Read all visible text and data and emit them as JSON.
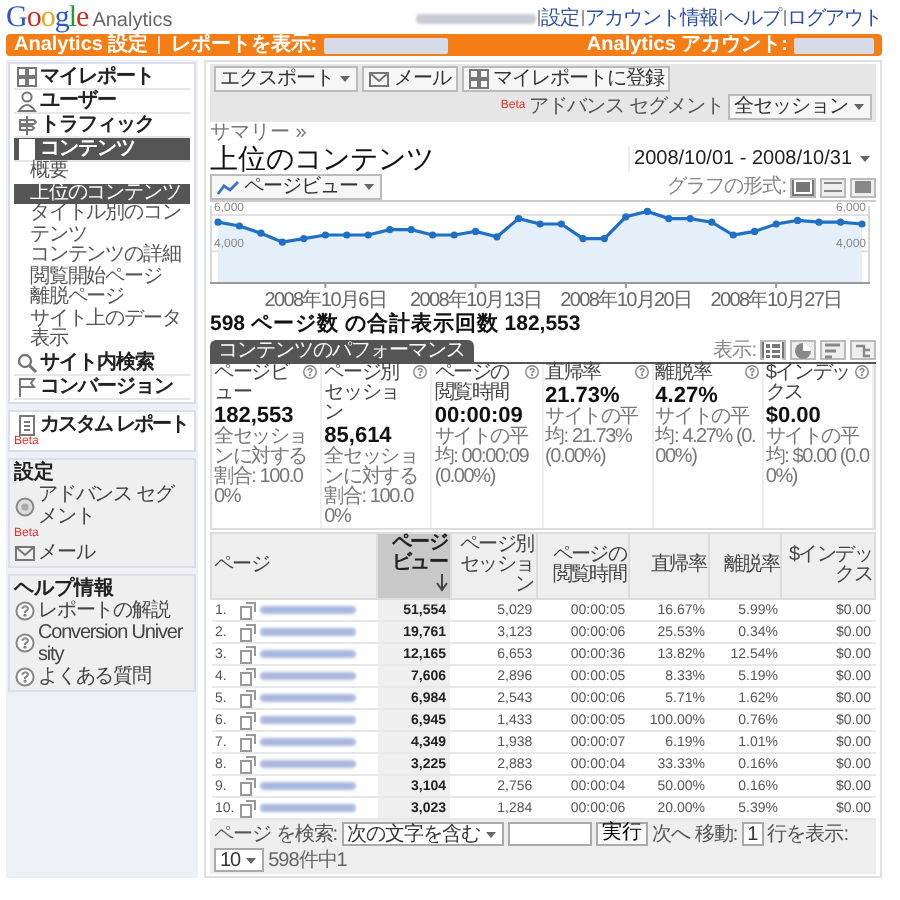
{
  "header": {
    "logo_word": "Google",
    "logo_product": "Analytics",
    "account_links": [
      "設定",
      "アカウント情報",
      "ヘルプ",
      "ログアウト"
    ]
  },
  "nav_bar": {
    "settings_link": "Analytics 設定",
    "report_label": "レポートを表示:",
    "account_label": "Analytics アカウント:"
  },
  "sidebar": {
    "items": [
      {
        "kind": "grid",
        "label": "マイレポート",
        "selected": false
      },
      {
        "kind": "person",
        "label": "ユーザー",
        "selected": false
      },
      {
        "kind": "traffic",
        "label": "トラフィック",
        "selected": false
      },
      {
        "kind": "content",
        "label": "コンテンツ",
        "selected": true,
        "children": [
          {
            "label": "概要",
            "selected": false
          },
          {
            "label": "上位のコンテンツ",
            "selected": true
          },
          {
            "label": "タイトル別のコンテンツ",
            "selected": false
          },
          {
            "label": "コンテンツの詳細",
            "selected": false
          },
          {
            "label": "閲覧開始ページ",
            "selected": false
          },
          {
            "label": "離脱ページ",
            "selected": false
          },
          {
            "label": "サイト上のデータ表示",
            "selected": false
          }
        ]
      },
      {
        "kind": "search",
        "label": "サイト内検索",
        "selected": false
      },
      {
        "kind": "flag",
        "label": "コンバージョン",
        "selected": false
      }
    ],
    "custom_report": {
      "label": "カスタム レポート",
      "badge": "Beta"
    },
    "settings": {
      "title": "設定",
      "items": [
        {
          "kind": "segment",
          "label": "アドバンス セグメント",
          "badge": "Beta"
        },
        {
          "kind": "mail",
          "label": "メール"
        }
      ]
    },
    "help": {
      "title": "ヘルプ情報",
      "items": [
        "レポートの解説",
        "Conversion University",
        "よくある質問"
      ]
    }
  },
  "toolbar": {
    "buttons": [
      {
        "kind": "menu",
        "label": "エクスポート"
      },
      {
        "kind": "mail",
        "label": "メール"
      },
      {
        "kind": "grid",
        "label": "マイレポートに登録"
      }
    ],
    "segment_badge": "Beta",
    "segment_label": "アドバンス セグメント",
    "segment_value": "全セッション"
  },
  "breadcrumb": "サマリー »",
  "title": "上位のコンテンツ",
  "date_range": "2008/10/01 - 2008/10/31",
  "chart": {
    "format_label": "グラフの形式:",
    "formats": [
      {
        "selected": true
      },
      {
        "selected": false
      },
      {
        "selected": false
      }
    ],
    "chart_data": {
      "type": "area",
      "categories": [
        null,
        null,
        null,
        null,
        null,
        "2008年10月6日",
        null,
        null,
        null,
        null,
        null,
        null,
        "2008年10月13日",
        null,
        null,
        null,
        null,
        null,
        null,
        "2008年10月20日",
        null,
        null,
        null,
        null,
        null,
        null,
        "2008年10月27日",
        null,
        null,
        null,
        null
      ],
      "series": [
        {
          "name": "ページビュー",
          "color": "#1f6fc5",
          "marker": "o",
          "values": [
            5600,
            5400,
            5000,
            4500,
            4700,
            4900,
            4900,
            4900,
            5200,
            5200,
            4900,
            4900,
            5100,
            4800,
            5800,
            5500,
            5500,
            4700,
            4700,
            5900,
            6200,
            5800,
            5800,
            5600,
            4900,
            5100,
            5500,
            5700,
            5600,
            5600,
            5500
          ]
        }
      ],
      "ylim": [
        2300,
        6500
      ],
      "yticks": [
        {
          "value": 4000,
          "label": "4,000"
        },
        {
          "value": 6000,
          "label": "6,000"
        }
      ],
      "y2lim": [
        2300,
        6500
      ],
      "y2ticks": [
        {
          "value": 4000,
          "label": "4,000"
        },
        {
          "value": 6000,
          "label": "6,000"
        }
      ]
    }
  },
  "summary": "598 ページ数 の合計表示回数 182,553",
  "performance": {
    "tab": "コンテンツのパフォーマンス",
    "view_label": "表示:",
    "views": [
      {
        "kind": "table",
        "selected": true
      },
      {
        "kind": "pie",
        "selected": false
      },
      {
        "kind": "bars",
        "selected": false
      },
      {
        "kind": "compare",
        "selected": false
      }
    ],
    "metrics": [
      {
        "label": "ページビュー",
        "value": "182,553",
        "note": "全セッションに対する割合: 100.00%"
      },
      {
        "label": "ページ別セッション",
        "value": "85,614",
        "note": "全セッションに対する割合: 100.00%"
      },
      {
        "label": "ページの閲覧時間",
        "value": "00:00:09",
        "note": "サイトの平均: 00:00:09 (0.00%)"
      },
      {
        "label": "直帰率",
        "value": "21.73%",
        "note": "サイトの平均: 21.73% (0.00%)"
      },
      {
        "label": "離脱率",
        "value": "4.27%",
        "note": "サイトの平均: 4.27% (0.00%)"
      },
      {
        "label": "$インデックス",
        "value": "$0.00",
        "note": "サイトの平均: $0.00 (0.00%)"
      }
    ]
  },
  "table": {
    "columns": [
      {
        "label": "ページ",
        "sorted": false
      },
      {
        "label": "ページビュー",
        "sorted": true
      },
      {
        "label": "ページ別セッション",
        "sorted": false
      },
      {
        "label": "ページの閲覧時間",
        "sorted": false
      },
      {
        "label": "直帰率",
        "sorted": false
      },
      {
        "label": "離脱率",
        "sorted": false
      },
      {
        "label": "$インデックス",
        "sorted": false
      }
    ],
    "rows": [
      {
        "cells": [
          "1.",
          "51,554",
          "5,029",
          "00:00:05",
          "16.67%",
          "5.99%",
          "$0.00"
        ]
      },
      {
        "cells": [
          "2.",
          "19,761",
          "3,123",
          "00:00:06",
          "25.53%",
          "0.34%",
          "$0.00"
        ]
      },
      {
        "cells": [
          "3.",
          "12,165",
          "6,653",
          "00:00:36",
          "13.82%",
          "12.54%",
          "$0.00"
        ]
      },
      {
        "cells": [
          "4.",
          "7,606",
          "2,896",
          "00:00:05",
          "8.33%",
          "5.19%",
          "$0.00"
        ]
      },
      {
        "cells": [
          "5.",
          "6,984",
          "2,543",
          "00:00:06",
          "5.71%",
          "1.62%",
          "$0.00"
        ]
      },
      {
        "cells": [
          "6.",
          "6,945",
          "1,433",
          "00:00:05",
          "100.00%",
          "0.76%",
          "$0.00"
        ]
      },
      {
        "cells": [
          "7.",
          "4,349",
          "1,938",
          "00:00:07",
          "6.19%",
          "1.01%",
          "$0.00"
        ]
      },
      {
        "cells": [
          "8.",
          "3,225",
          "2,883",
          "00:00:04",
          "33.33%",
          "0.16%",
          "$0.00"
        ]
      },
      {
        "cells": [
          "9.",
          "3,104",
          "2,756",
          "00:00:04",
          "50.00%",
          "0.16%",
          "$0.00"
        ]
      },
      {
        "cells": [
          "10.",
          "3,023",
          "1,284",
          "00:00:06",
          "20.00%",
          "5.39%",
          "$0.00"
        ]
      }
    ]
  },
  "footer": {
    "search_label": "ページ を検索:",
    "match_value": "次の文字を含む",
    "go_button": "実行",
    "jump_label": "次へ 移動:",
    "jump_value": "1",
    "rows_label": "行を表示:",
    "rows_value": "10",
    "count": "598件中1"
  }
}
